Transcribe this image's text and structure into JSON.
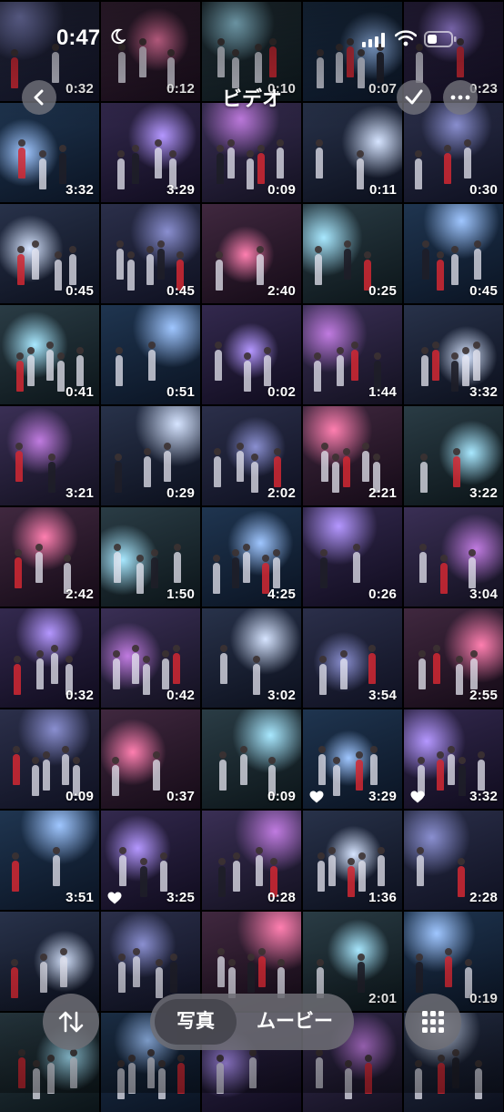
{
  "status": {
    "time": "0:47"
  },
  "nav": {
    "title": "ビデオ"
  },
  "toolbar": {
    "photos_label": "写真",
    "movies_label": "ムービー"
  },
  "icons": [
    "chevron-left-icon",
    "checkmark-icon",
    "more-icon",
    "sort-icon",
    "grid-icon",
    "heart-icon",
    "moon-icon",
    "signal-icon",
    "wifi-icon",
    "battery-icon"
  ],
  "videos": [
    {
      "duration": "0:32",
      "fav": false
    },
    {
      "duration": "0:12",
      "fav": false
    },
    {
      "duration": "0:10",
      "fav": false
    },
    {
      "duration": "0:07",
      "fav": false
    },
    {
      "duration": "0:23",
      "fav": false
    },
    {
      "duration": "3:32",
      "fav": false
    },
    {
      "duration": "3:29",
      "fav": false
    },
    {
      "duration": "0:09",
      "fav": false
    },
    {
      "duration": "0:11",
      "fav": false
    },
    {
      "duration": "0:30",
      "fav": false
    },
    {
      "duration": "0:45",
      "fav": false
    },
    {
      "duration": "0:45",
      "fav": false
    },
    {
      "duration": "2:40",
      "fav": false
    },
    {
      "duration": "0:25",
      "fav": false
    },
    {
      "duration": "0:45",
      "fav": false
    },
    {
      "duration": "0:41",
      "fav": false
    },
    {
      "duration": "0:51",
      "fav": false
    },
    {
      "duration": "0:02",
      "fav": false
    },
    {
      "duration": "1:44",
      "fav": false
    },
    {
      "duration": "3:32",
      "fav": false
    },
    {
      "duration": "3:21",
      "fav": false
    },
    {
      "duration": "0:29",
      "fav": false
    },
    {
      "duration": "2:02",
      "fav": false
    },
    {
      "duration": "2:21",
      "fav": false
    },
    {
      "duration": "3:22",
      "fav": false
    },
    {
      "duration": "2:42",
      "fav": false
    },
    {
      "duration": "1:50",
      "fav": false
    },
    {
      "duration": "4:25",
      "fav": false
    },
    {
      "duration": "0:26",
      "fav": false
    },
    {
      "duration": "3:04",
      "fav": false
    },
    {
      "duration": "0:32",
      "fav": false
    },
    {
      "duration": "0:42",
      "fav": false
    },
    {
      "duration": "3:02",
      "fav": false
    },
    {
      "duration": "3:54",
      "fav": false
    },
    {
      "duration": "2:55",
      "fav": false
    },
    {
      "duration": "0:09",
      "fav": false
    },
    {
      "duration": "0:37",
      "fav": false
    },
    {
      "duration": "0:09",
      "fav": false
    },
    {
      "duration": "3:29",
      "fav": true
    },
    {
      "duration": "3:32",
      "fav": true
    },
    {
      "duration": "3:51",
      "fav": false
    },
    {
      "duration": "3:25",
      "fav": true
    },
    {
      "duration": "0:28",
      "fav": false
    },
    {
      "duration": "1:36",
      "fav": false
    },
    {
      "duration": "2:28",
      "fav": false
    },
    {
      "duration": "",
      "fav": false
    },
    {
      "duration": "",
      "fav": false
    },
    {
      "duration": "",
      "fav": false
    },
    {
      "duration": "2:01",
      "fav": false
    },
    {
      "duration": "0:19",
      "fav": false
    },
    {
      "duration": "",
      "fav": false
    },
    {
      "duration": "",
      "fav": false
    },
    {
      "duration": "",
      "fav": false
    },
    {
      "duration": "",
      "fav": false
    },
    {
      "duration": "",
      "fav": false
    }
  ]
}
